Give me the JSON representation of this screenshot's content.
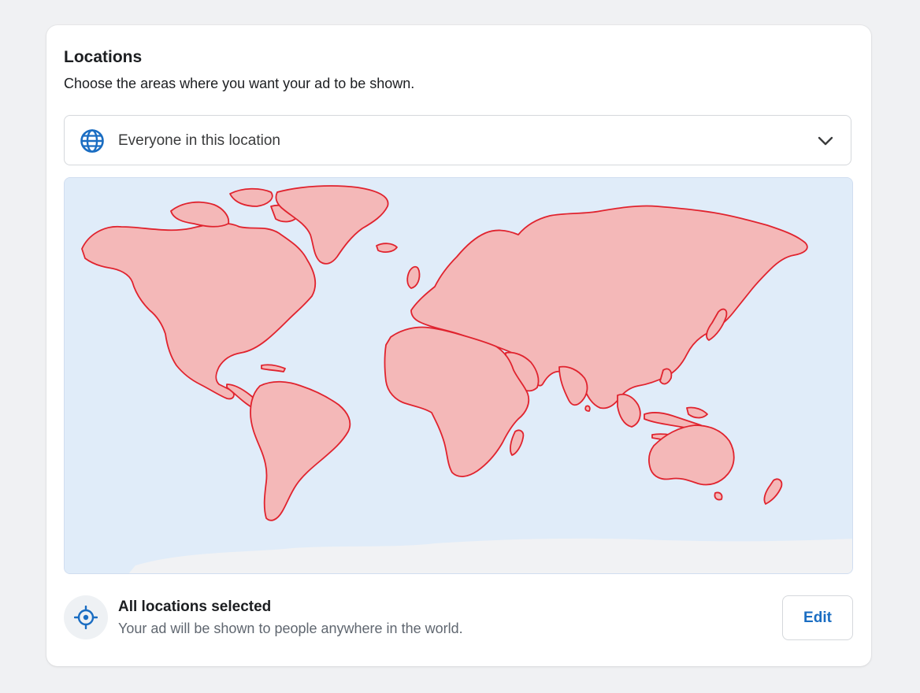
{
  "section": {
    "title": "Locations",
    "subtitle": "Choose the areas where you want your ad to be shown."
  },
  "audience_dropdown": {
    "selected": "Everyone in this location",
    "icon": "globe-icon",
    "caret_icon": "chevron-down-icon"
  },
  "map": {
    "highlight_fill": "#f4b8b8",
    "highlight_stroke": "#e0232e",
    "ocean_color": "#e0ecf9"
  },
  "summary": {
    "icon": "target-icon",
    "title": "All locations selected",
    "description": "Your ad will be shown to people anywhere in the world.",
    "edit_label": "Edit"
  },
  "colors": {
    "accent": "#1a6dc2",
    "text_primary": "#1c1e21",
    "text_secondary": "#606770"
  }
}
